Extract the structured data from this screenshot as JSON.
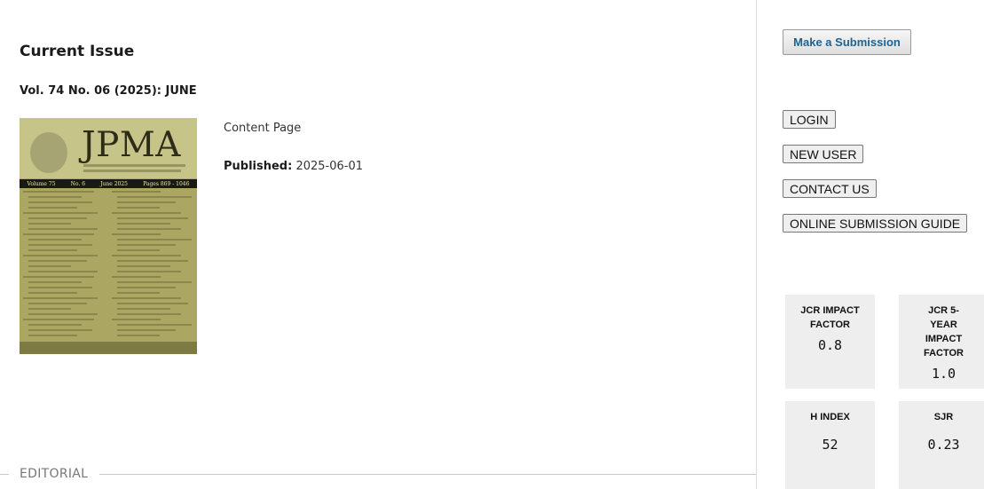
{
  "current_issue": {
    "heading": "Current Issue",
    "volume_title": "Vol. 74 No. 06 (2025): JUNE",
    "cover": {
      "logo_text": "JPMA",
      "volume": "Volume 75",
      "number": "No. 6",
      "month": "June 2025",
      "pages": "Pages 869 - 1046",
      "colors": {
        "background": "#aba762",
        "top": "#c7c48a",
        "band": "#1a1a14"
      }
    },
    "content_page_label": "Content Page",
    "published_label": "Published:",
    "published_date": "2025-06-01"
  },
  "section": {
    "label": "EDITORIAL"
  },
  "sidebar": {
    "submit_label": "Make a Submission",
    "nav": [
      {
        "label": "LOGIN"
      },
      {
        "label": "NEW USER"
      },
      {
        "label": "CONTACT US"
      },
      {
        "label": "ONLINE SUBMISSION GUIDE"
      }
    ],
    "metrics": [
      {
        "label": "JCR IMPACT FACTOR",
        "value": "0.8"
      },
      {
        "label": "JCR 5-YEAR IMPACT FACTOR",
        "value": "1.0"
      },
      {
        "label": "H INDEX",
        "value": "52"
      },
      {
        "label": "SJR",
        "value": "0.23"
      }
    ]
  },
  "theme": {
    "link_color": "#1e6292",
    "metric_bg": "#eeeeee"
  }
}
